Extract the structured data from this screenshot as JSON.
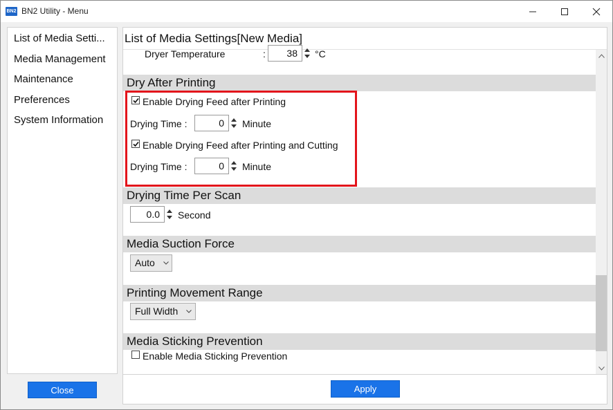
{
  "window": {
    "icon_text": "BN2",
    "title": "BN2 Utility - Menu"
  },
  "sidebar": {
    "items": [
      {
        "label": "List of Media Setti..."
      },
      {
        "label": "Media Management"
      },
      {
        "label": "Maintenance"
      },
      {
        "label": "Preferences"
      },
      {
        "label": "System Information"
      }
    ],
    "close_label": "Close"
  },
  "main": {
    "title": "List of Media Settings[New Media]",
    "dryer": {
      "label": "Dryer Temperature",
      "colon": ":",
      "value": "38",
      "unit": "°C"
    },
    "dry_after_printing": {
      "header": "Dry After Printing",
      "feed_after_printing": {
        "label": "Enable Drying Feed after Printing",
        "checked": true
      },
      "drying_time_1": {
        "label": "Drying Time :",
        "value": "0",
        "unit": "Minute"
      },
      "feed_after_cutting": {
        "label": "Enable Drying Feed after Printing and Cutting",
        "checked": true
      },
      "drying_time_2": {
        "label": "Drying Time :",
        "value": "0",
        "unit": "Minute"
      }
    },
    "drying_time_per_scan": {
      "header": "Drying Time Per Scan",
      "value": "0.0",
      "unit": "Second"
    },
    "media_suction_force": {
      "header": "Media Suction Force",
      "selected": "Auto"
    },
    "printing_movement_range": {
      "header": "Printing Movement Range",
      "selected": "Full Width"
    },
    "media_sticking_prevention": {
      "header": "Media Sticking Prevention",
      "checkbox": {
        "label": "Enable Media Sticking Prevention",
        "checked": false
      }
    },
    "apply_label": "Apply"
  },
  "colors": {
    "accent": "#1a73e8",
    "highlight": "#e3141b",
    "section_bg": "#dcdcdc"
  }
}
